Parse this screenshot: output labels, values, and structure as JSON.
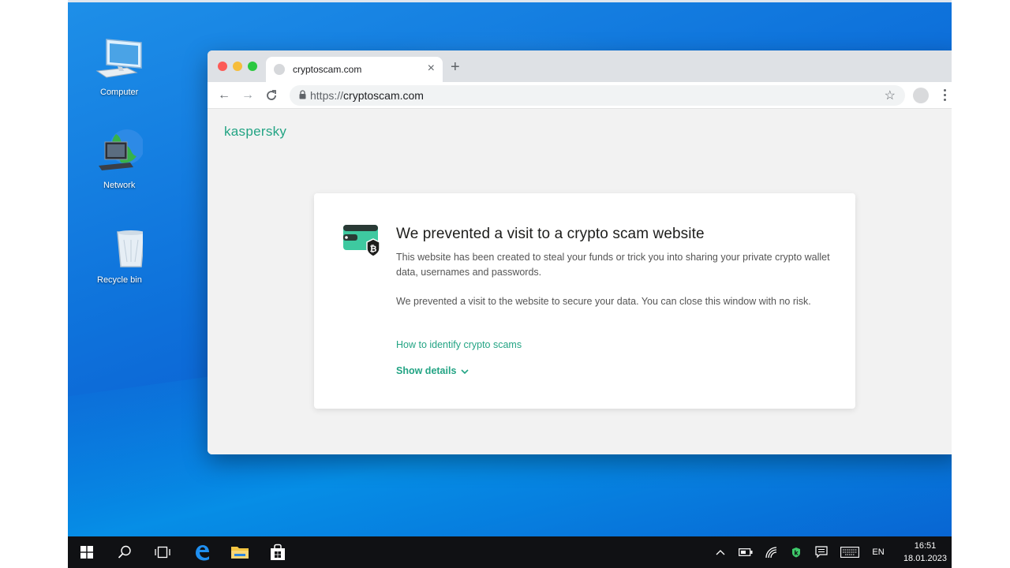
{
  "desktop": {
    "icons": [
      {
        "name": "computer",
        "label": "Computer"
      },
      {
        "name": "network",
        "label": "Network"
      },
      {
        "name": "recycle-bin",
        "label": "Recycle bin"
      }
    ]
  },
  "browser": {
    "tab": {
      "title": "cryptoscam.com",
      "close_glyph": "×"
    },
    "new_tab_glyph": "+",
    "nav": {
      "back": "←",
      "forward": "→",
      "reload": "C"
    },
    "address": {
      "scheme": "https://",
      "host": "cryptoscam.com"
    },
    "star_glyph": "☆"
  },
  "page": {
    "brand": "kaspersky",
    "card": {
      "title": "We prevented a visit to a crypto scam website",
      "paragraph1": "This website has been created to steal your funds or trick you into sharing your private crypto wallet data, usernames and passwords.",
      "paragraph2": "We prevented a visit to the website to secure your data. You can close this window with no risk.",
      "link": "How to identify crypto scams",
      "details": "Show details",
      "wallet_badge": "₿"
    }
  },
  "taskbar": {
    "tray": {
      "language": "EN",
      "time": "16:51",
      "date": "18.01.2023"
    }
  },
  "colors": {
    "accent": "#23a484",
    "wallet": "#3ec9a0"
  }
}
